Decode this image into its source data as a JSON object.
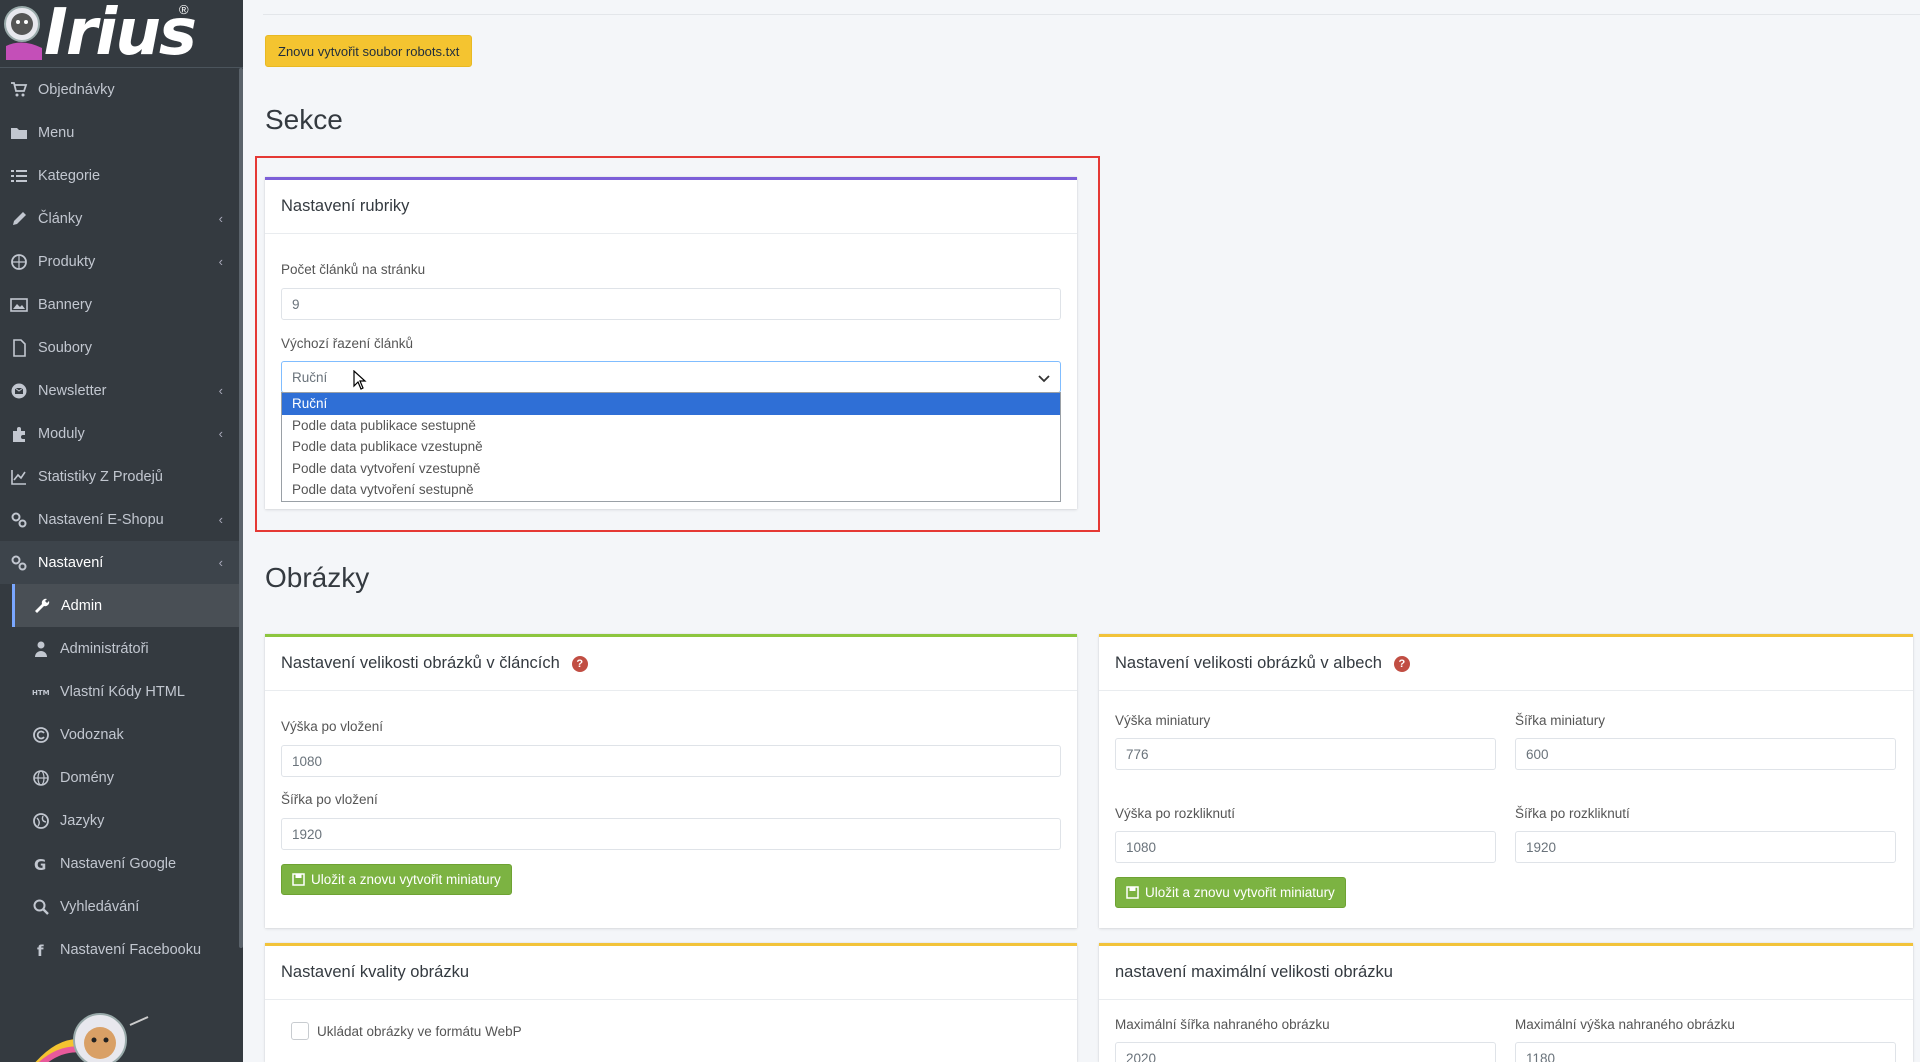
{
  "brand": {
    "logo_text": "Irius",
    "reg_mark": "®"
  },
  "sidebar": {
    "items": [
      {
        "label": "Objednávky",
        "icon": "cart-icon",
        "has_children": false
      },
      {
        "label": "Menu",
        "icon": "folder-icon",
        "has_children": false
      },
      {
        "label": "Kategorie",
        "icon": "list-icon",
        "has_children": false
      },
      {
        "label": "Články",
        "icon": "pencil-icon",
        "has_children": true
      },
      {
        "label": "Produkty",
        "icon": "basketball-icon",
        "has_children": true
      },
      {
        "label": "Bannery",
        "icon": "image-icon",
        "has_children": false
      },
      {
        "label": "Soubory",
        "icon": "file-icon",
        "has_children": false
      },
      {
        "label": "Newsletter",
        "icon": "mail-circle-icon",
        "has_children": true
      },
      {
        "label": "Moduly",
        "icon": "puzzle-icon",
        "has_children": true
      },
      {
        "label": "Statistiky Z Prodejů",
        "icon": "chart-icon",
        "has_children": false
      },
      {
        "label": "Nastavení E-Shopu",
        "icon": "cogs-icon",
        "has_children": true
      },
      {
        "label": "Nastavení",
        "icon": "cogs-icon",
        "has_children": true,
        "open": true
      }
    ],
    "sub_items": [
      {
        "label": "Admin",
        "icon": "wrench-icon",
        "active": true
      },
      {
        "label": "Administrátoři",
        "icon": "user-icon"
      },
      {
        "label": "Vlastní Kódy HTML",
        "icon": "html-icon"
      },
      {
        "label": "Vodoznak",
        "icon": "copyright-icon"
      },
      {
        "label": "Domény",
        "icon": "globe-icon"
      },
      {
        "label": "Jazyky",
        "icon": "language-icon"
      },
      {
        "label": "Nastavení Google",
        "icon": "google-icon"
      },
      {
        "label": "Vyhledávání",
        "icon": "search-icon"
      },
      {
        "label": "Nastavení Facebooku",
        "icon": "facebook-icon"
      }
    ]
  },
  "toolbar": {
    "robots_button": "Znovu vytvořit soubor robots.txt"
  },
  "sections": {
    "sekce_title": "Sekce",
    "obrazky_title": "Obrázky"
  },
  "rubrika": {
    "title": "Nastavení rubriky",
    "per_page_label": "Počet článků na stránku",
    "per_page_value": "9",
    "sort_label": "Výchozí řazení článků",
    "sort_value": "Ruční",
    "sort_options": [
      "Ruční",
      "Podle data publikace sestupně",
      "Podle data publikace vzestupně",
      "Podle data vytvoření vzestupně",
      "Podle data vytvoření sestupně"
    ]
  },
  "clanky_images": {
    "title": "Nastavení velikosti obrázků v článcích",
    "height_label": "Výška po vložení",
    "height_value": "1080",
    "width_label": "Šířka po vložení",
    "width_value": "1920",
    "save_button": "Uložit a znovu vytvořit miniatury"
  },
  "album_images": {
    "title": "Nastavení velikosti obrázků v albech",
    "thumb_height_label": "Výška miniatury",
    "thumb_height_value": "776",
    "thumb_width_label": "Šířka miniatury",
    "thumb_width_value": "600",
    "open_height_label": "Výška po rozkliknutí",
    "open_height_value": "1080",
    "open_width_label": "Šířka po rozkliknutí",
    "open_width_value": "1920",
    "save_button": "Uložit a znovu vytvořit miniatury"
  },
  "quality": {
    "title": "Nastavení kvality obrázku",
    "webp_label": "Ukládat obrázky ve formátu WebP"
  },
  "max_size": {
    "title": "nastavení maximální velikosti obrázku",
    "max_width_label": "Maximální šířka nahraného obrázku",
    "max_width_value": "2020",
    "max_height_label": "Maximální výška nahraného obrázku",
    "max_height_value": "1180"
  },
  "colors": {
    "sidebar_bg": "#343a40",
    "accent_purple": "#7c5fd8",
    "accent_green": "#8dc63f",
    "accent_yellow": "#f2c33a",
    "highlight_red": "#e53935",
    "selected_blue": "#2f6fd6"
  }
}
